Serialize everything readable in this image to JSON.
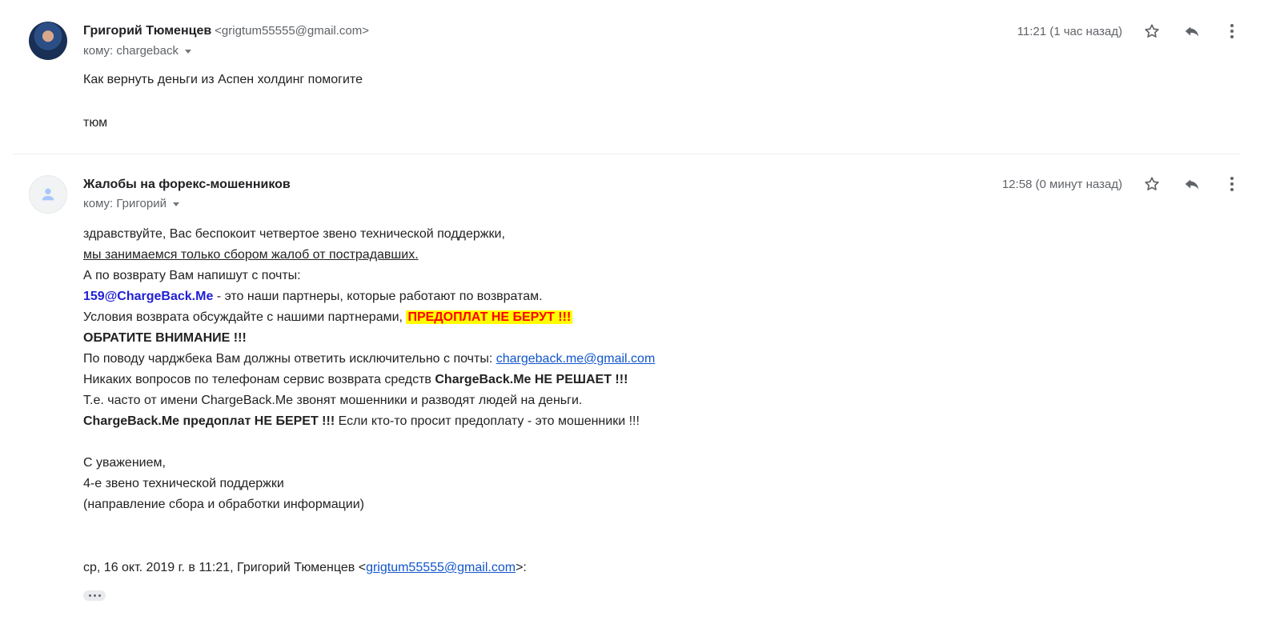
{
  "message1": {
    "sender_name": "Григорий Тюменцев",
    "sender_email": "<grigtum55555@gmail.com>",
    "recipient": "кому: chargeback",
    "time": "11:21 (1 час назад)",
    "body_line1": "Как вернуть деньги из Аспен холдинг помогите",
    "body_line2": "тюм",
    "avatar_icon": "user-photo"
  },
  "message2": {
    "sender_name": "Жалобы на форекс-мошенников",
    "recipient": "кому: Григорий",
    "time": "12:58 (0 минут назад)",
    "avatar_icon": "default-person-icon",
    "lines": {
      "l1": "здравствуйте, Вас беспокоит четвертое звено технической поддержки,",
      "l2": "мы занимаемся только сбором жалоб от пострадавших.",
      "l3": "А по возврату Вам напишут с почты:",
      "l4_link": "159@ChargeBack.Me",
      "l4_rest": " - это наши партнеры, которые работают по возвратам.",
      "l5_text": "Условия возврата обсуждайте с нашими партнерами, ",
      "l5_highlight": "ПРЕДОПЛАТ НЕ БЕРУТ !!!",
      "l6": "ОБРАТИТЕ ВНИМАНИЕ !!!",
      "l7_text": "По поводу чарджбека Вам должны ответить исключительно с почты: ",
      "l7_link": "chargeback.me@gmail.com",
      "l8_text": "Никаких вопросов по телефонам сервис возврата средств ",
      "l8_bold": "ChargeBack.Me НЕ РЕШАЕТ !!!",
      "l9": "Т.е. часто от имени ChargeBack.Me звонят мошенники и разводят людей на деньги.",
      "l10_bold": "ChargeBack.Me предоплат НЕ БЕРЕТ !!!",
      "l10_rest": " Если кто-то просит предоплату - это мошенники !!!",
      "sig1": "С уважением,",
      "sig2": "4-е звено технической поддержки",
      "sig3": "(направление сбора и обработки информации)",
      "quote_prefix": "ср, 16 окт. 2019 г. в 11:21, Григорий Тюменцев <",
      "quote_email": "grigtum55555@gmail.com",
      "quote_suffix": ">:"
    }
  },
  "icons": {
    "star": "star-icon",
    "reply": "reply-icon",
    "more": "more-vert-icon",
    "expand": "ellipsis-icon"
  },
  "colors": {
    "link": "#1155cc",
    "highlight_bg": "#ffff00",
    "highlight_fg": "#ff0000",
    "partner_link": "#1f1fd6"
  }
}
